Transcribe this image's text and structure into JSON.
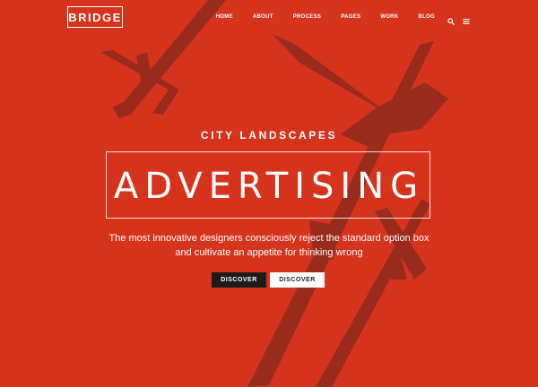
{
  "brand": {
    "logo": "BRIDGE"
  },
  "nav": {
    "items": [
      "HOME",
      "ABOUT",
      "PROCESS",
      "PAGES",
      "WORK",
      "BLOG"
    ],
    "search_icon": "search-icon",
    "menu_icon": "menu-icon"
  },
  "hero": {
    "subtitle": "CITY LANDSCAPES",
    "headline": "ADVERTISING",
    "description_line1": "The most innovative designers consciously reject the standard option box",
    "description_line2": "and cultivate an appetite for thinking wrong",
    "button_primary": "DISCOVER",
    "button_secondary": "DISCOVER"
  },
  "colors": {
    "background": "#d6331c",
    "plane_shadow": "#8e2a1d",
    "button_dark": "#1c1c1c",
    "button_light": "#ffffff"
  }
}
